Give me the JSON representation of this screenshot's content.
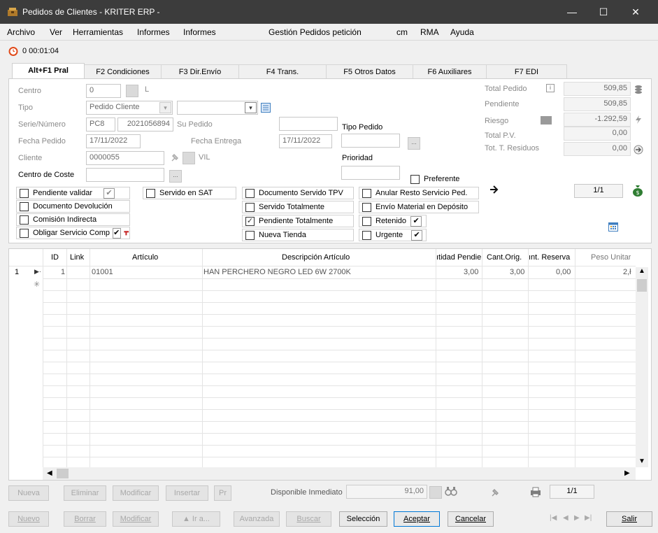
{
  "window": {
    "title": "Pedidos de Clientes - KRITER ERP -",
    "minimize": "—",
    "maximize": "☐",
    "close": "✕"
  },
  "menu": [
    "Archivo",
    "Ver",
    "Herramientas",
    "Informes",
    "Informes",
    "Gestión Pedidos petición",
    "cm",
    "RMA",
    "Ayuda"
  ],
  "timer": {
    "value": "0 00:01:04"
  },
  "tabs": [
    "Alt+F1 Pral",
    "F2 Condiciones",
    "F3 Dir.Envío",
    "F4 Trans.",
    "F5 Otros Datos",
    "F6 Auxiliares",
    "F7 EDI"
  ],
  "form": {
    "centro_label": "Centro",
    "centro_value": "0",
    "centro_suffix": "L",
    "tipo_label": "Tipo",
    "tipo_value": "Pedido Cliente",
    "serie_label": "Serie/Número",
    "serie_value": "PC8",
    "numero_value": "2021056894",
    "supedido_label": "Su Pedido",
    "fecha_pedido_label": "Fecha Pedido",
    "fecha_pedido_value": "17/11/2022",
    "fecha_entrega_label": "Fecha Entrega",
    "fecha_entrega_value": "17/11/2022",
    "tipo_pedido_label": "Tipo Pedido",
    "cliente_label": "Cliente",
    "cliente_value": "0000055",
    "cliente_suffix": "VIL",
    "prioridad_label": "Prioridad",
    "centro_coste_label": "Centro de Coste",
    "preferente_label": "Preferente",
    "ellipsis": "..."
  },
  "totals": {
    "total_pedido_label": "Total Pedido",
    "total_pedido_value": "509,85",
    "pendiente_label": "Pendiente",
    "pendiente_value": "509,85",
    "riesgo_label": "Riesgo",
    "riesgo_value": "-1.292,59",
    "total_pv_label": "Total P.V.",
    "total_pv_value": "0,00",
    "residuos_label": "Tot. T. Residuos",
    "residuos_value": "0,00",
    "pager": "1/1",
    "info_glyph": "i"
  },
  "checks": {
    "col1": [
      {
        "label": "Pendiente validar",
        "checked": false
      },
      {
        "label": "Documento Devolución",
        "checked": false
      },
      {
        "label": "Comisión Indirecta",
        "checked": false
      },
      {
        "label": "Obligar Servicio Comp",
        "checked": false
      }
    ],
    "servido_sat": "Servido en SAT",
    "col3": [
      {
        "label": "Documento Servido TPV",
        "mark": ""
      },
      {
        "label": "Servido Totalmente",
        "mark": ""
      },
      {
        "label": "Pendiente Totalmente",
        "mark": "✓"
      },
      {
        "label": "Nueva Tienda",
        "mark": ""
      }
    ],
    "col4": [
      {
        "label": "Anular Resto Servicio Ped.",
        "mark": ""
      },
      {
        "label": "Envío Material en Depósito",
        "mark": ""
      },
      {
        "label": "Retenido",
        "mark": ""
      },
      {
        "label": "Urgente",
        "mark": ""
      }
    ],
    "tick": "✔"
  },
  "grid": {
    "headers": [
      "ID",
      "Link",
      "Artículo",
      "Descripción Artículo",
      "ıtidad Pendie",
      "Cant.Orig.",
      "ınt. Reserva",
      "Peso Unitar"
    ],
    "row": {
      "num": "1",
      "id": "1",
      "articulo": "01001",
      "descripcion": "HAN PERCHERO NEGRO LED 6W 2700K",
      "pendiente": "3,00",
      "orig": "3,00",
      "reserva": "0,00",
      "peso": "2,ł"
    },
    "new_row_glyph": "✳"
  },
  "toolbar1": {
    "nueva": "Nueva",
    "eliminar": "Eliminar",
    "modificar": "Modificar",
    "insertar": "Insertar",
    "pr": "Pr",
    "disponible_label": "Disponible Inmediato",
    "disponible_value": "91,00",
    "pager": "1/1"
  },
  "toolbar2": {
    "nuevo": "Nuevo",
    "borrar": "Borrar",
    "modificar": "Modificar",
    "ira": "▲ Ir a...",
    "avanzada": "Avanzada",
    "buscar": "Buscar",
    "seleccion": "Selección",
    "aceptar": "Aceptar",
    "cancelar": "Cancelar",
    "salir": "Salir",
    "nav_first": "|◀",
    "nav_prev": "◀",
    "nav_next": "▶",
    "nav_last": "▶|"
  },
  "colors": {
    "titlebar": "#3c3c3c",
    "accent": "#0078d7",
    "money_green": "#2f7d32"
  }
}
